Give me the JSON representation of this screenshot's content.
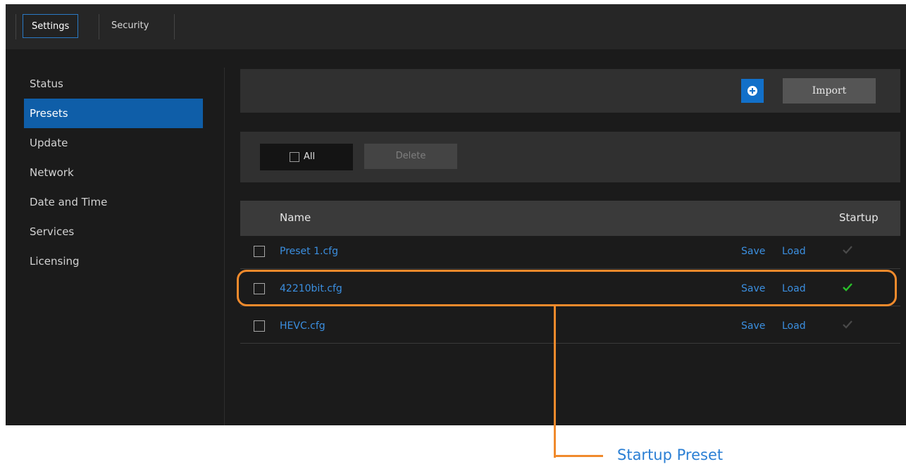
{
  "tabs": [
    {
      "label": "Settings",
      "active": true
    },
    {
      "label": "Security",
      "active": false
    }
  ],
  "sidebar": {
    "items": [
      {
        "label": "Status"
      },
      {
        "label": "Presets",
        "active": true
      },
      {
        "label": "Update"
      },
      {
        "label": "Network"
      },
      {
        "label": "Date and Time"
      },
      {
        "label": "Services"
      },
      {
        "label": "Licensing"
      }
    ]
  },
  "toolbar": {
    "add_icon": "plus-circle-icon",
    "import_label": "Import"
  },
  "selection": {
    "all_label": "All",
    "delete_label": "Delete"
  },
  "table": {
    "columns": {
      "name": "Name",
      "startup": "Startup"
    },
    "rows": [
      {
        "name": "Preset 1.cfg",
        "save": "Save",
        "load": "Load",
        "startup": false
      },
      {
        "name": "42210bit.cfg",
        "save": "Save",
        "load": "Load",
        "startup": true
      },
      {
        "name": "HEVC.cfg",
        "save": "Save",
        "load": "Load",
        "startup": false
      }
    ]
  },
  "callout": {
    "label": "Startup Preset"
  },
  "colors": {
    "accent": "#1270c9",
    "link": "#3b8fe0",
    "startup_check": "#29c02a",
    "callout": "#f08a2c"
  }
}
